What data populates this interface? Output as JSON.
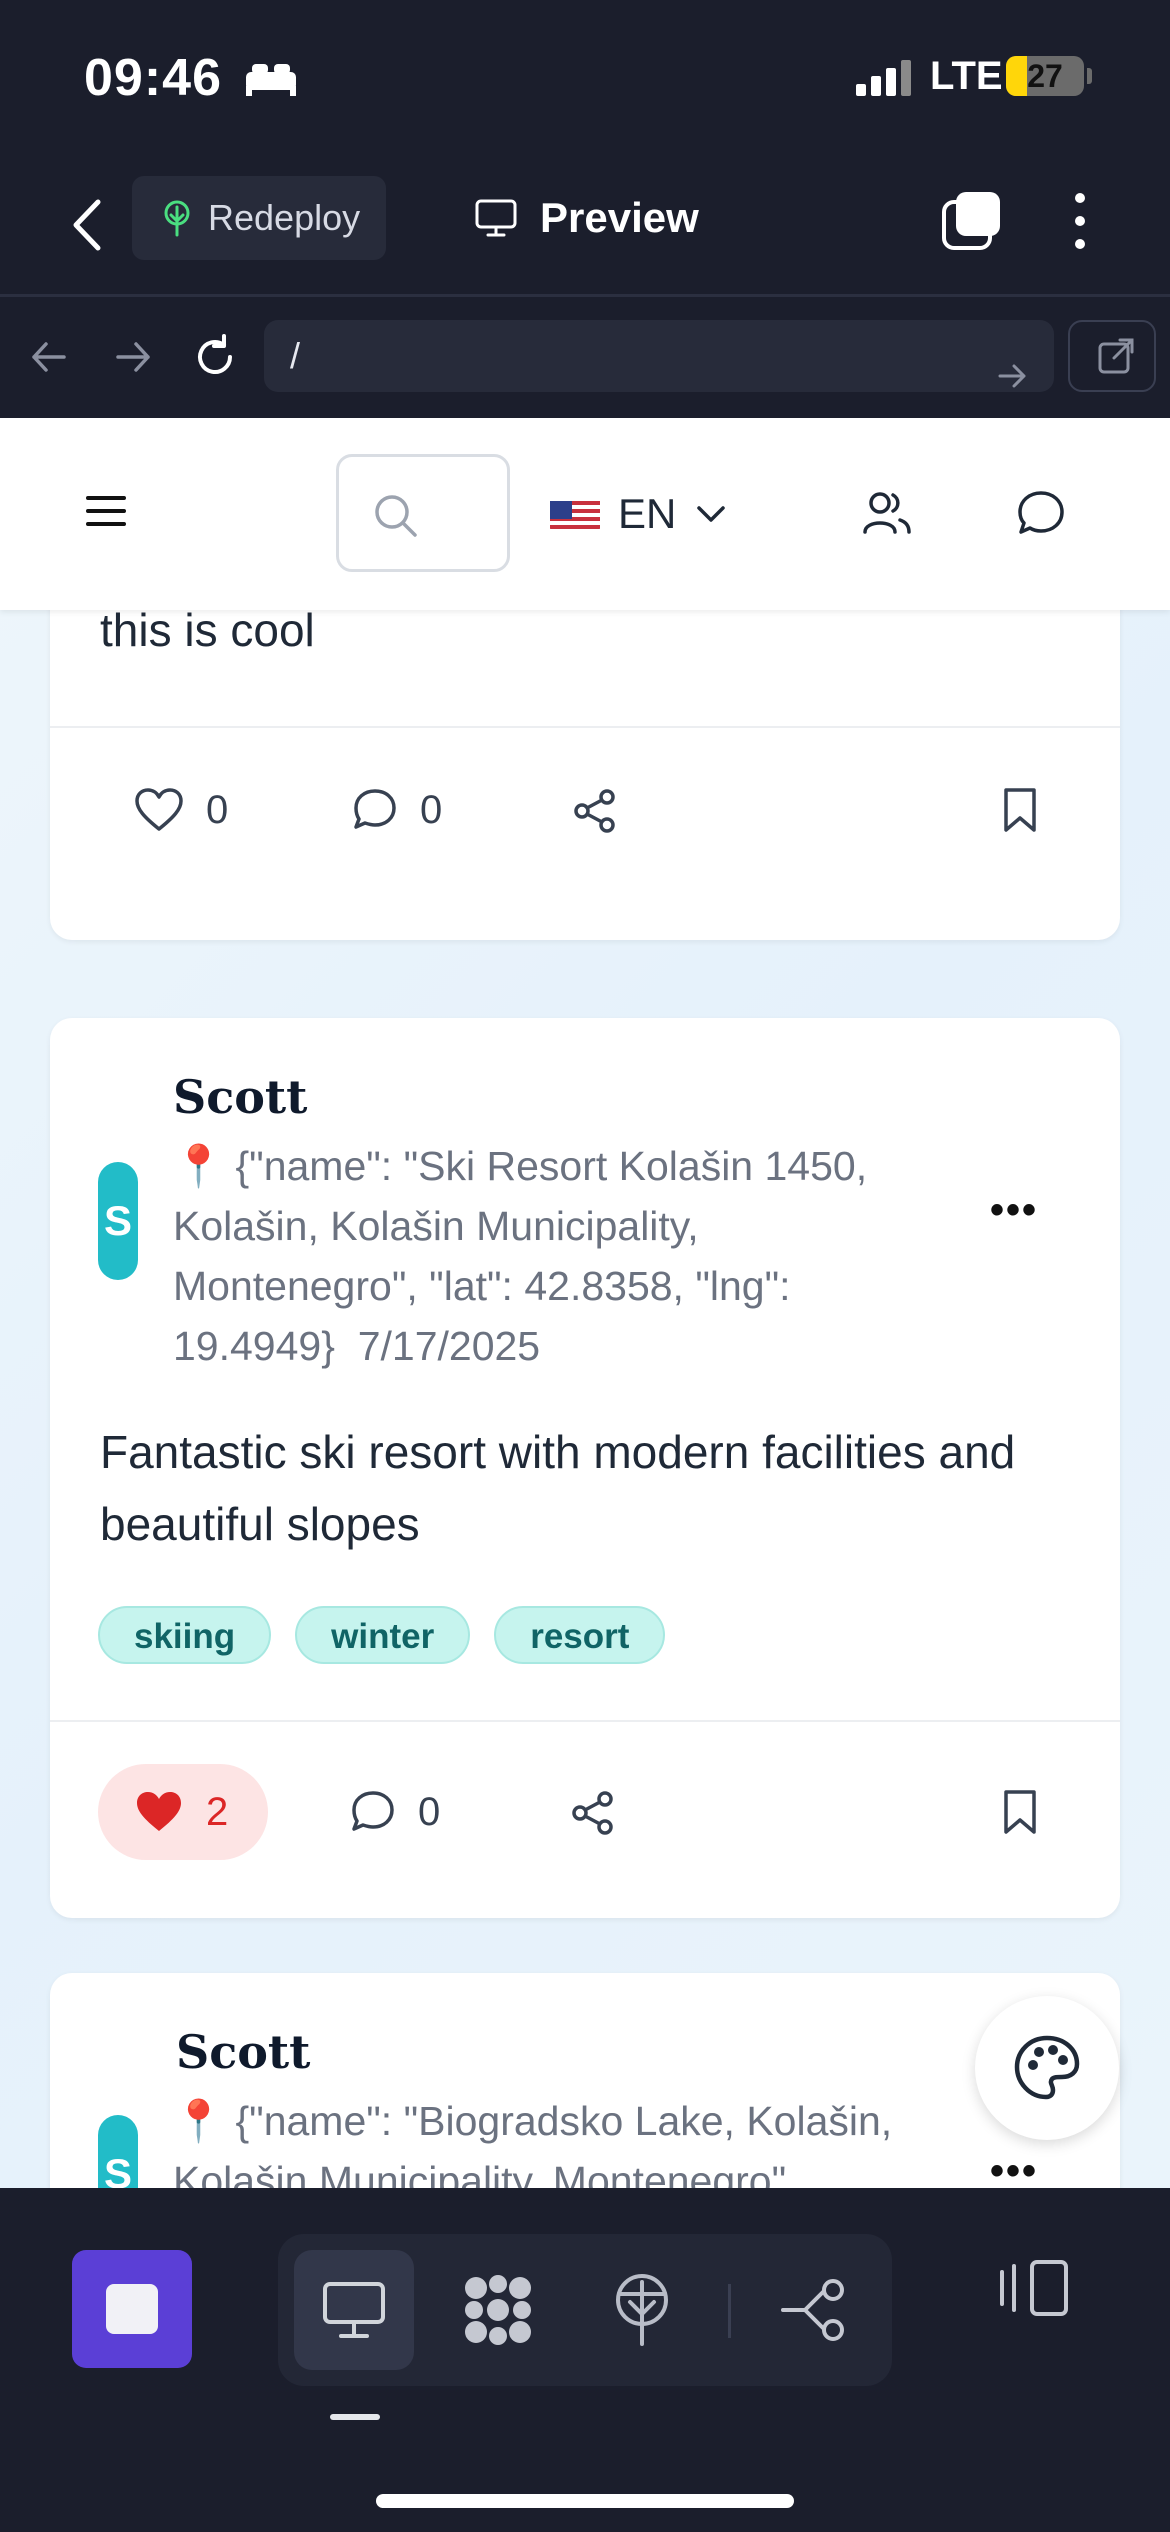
{
  "status_bar": {
    "time": "09:46",
    "network": "LTE",
    "battery": "27",
    "battery_level": 0.27
  },
  "app_bar": {
    "redeploy_label": "Redeploy",
    "preview_label": "Preview"
  },
  "url_bar": {
    "url": "/"
  },
  "site_header": {
    "language": "EN"
  },
  "posts": [
    {
      "body": "this is cool",
      "likes": "0",
      "comments": "0"
    },
    {
      "author": "Scott",
      "avatar_letter": "S",
      "location": "📍 {\"name\": \"Ski Resort Kolašin 1450, Kolašin, Kolašin Municipality, Montenegro\", \"lat\": 42.8358, \"lng\": 19.4949}",
      "date": "7/17/2025",
      "body": "Fantastic ski resort with modern facilities and beautiful slopes",
      "tags": [
        "skiing",
        "winter",
        "resort"
      ],
      "likes": "2",
      "comments": "0"
    },
    {
      "author": "Scott",
      "avatar_letter": "S",
      "location": "📍 {\"name\": \"Biogradsko Lake, Kolašin, Kolašin Municipality, Montenegro\""
    }
  ],
  "colors": {
    "accent": "#5b3fd6",
    "like": "#dc2626",
    "tag_bg": "#c6f4ee",
    "avatar": "#22bcc8"
  }
}
